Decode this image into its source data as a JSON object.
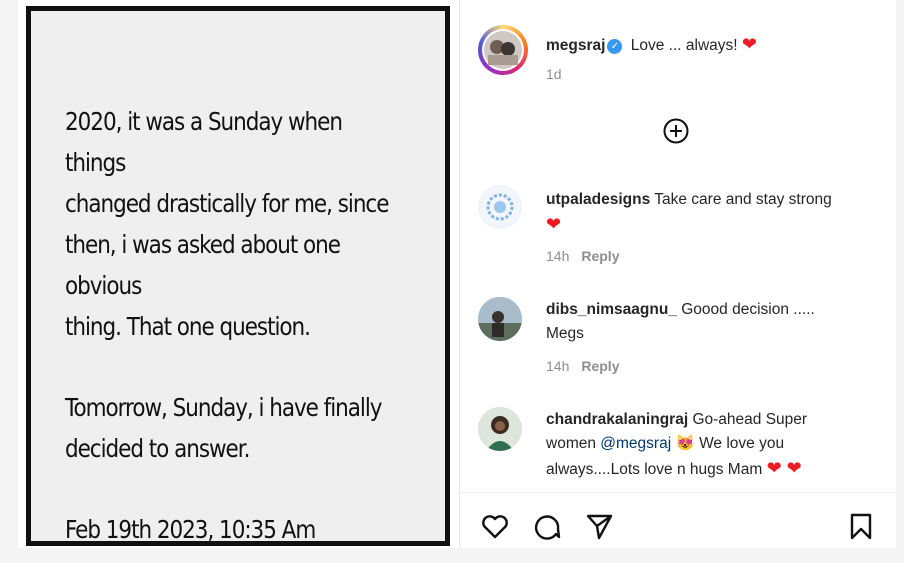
{
  "post": {
    "paragraph1": "2020, it was a Sunday when things\nchanged drastically for me, since\nthen, i was asked about one obvious\nthing. That one question.",
    "paragraph2": "Tomorrow, Sunday, i have finally\ndecided to answer.",
    "date": "Feb 19th 2023, 10:35 Am"
  },
  "caption": {
    "username": "megsraj",
    "text": "Love ... always!",
    "heart": "❤",
    "time": "1d",
    "verified_icon": "verified-badge-icon"
  },
  "load_more_icon": "plus-circle-icon",
  "comments": [
    {
      "username": "utpaladesigns",
      "text": "Take care and stay strong",
      "line2": "❤",
      "time": "14h",
      "reply": "Reply"
    },
    {
      "username": "dibs_nimsaagnu_",
      "text": "Goood decision .....",
      "line2": "Megs",
      "time": "14h",
      "reply": "Reply"
    },
    {
      "username": "chandrakalaningraj",
      "text": "Go-ahead Super",
      "line2_prefix": "women ",
      "mention": "@megsraj",
      "emoji": "😻",
      "line2_suffix": " We love you",
      "line3": "always....Lots love n hugs Mam",
      "hearts": "❤ ❤"
    }
  ],
  "action_icons": [
    "heart-icon",
    "comment-icon",
    "share-icon",
    "bookmark-icon"
  ],
  "colors": {
    "heart": "#ed1c24",
    "verified": "#3897f0",
    "mention": "#00376b",
    "meta": "#8e8e8e"
  }
}
